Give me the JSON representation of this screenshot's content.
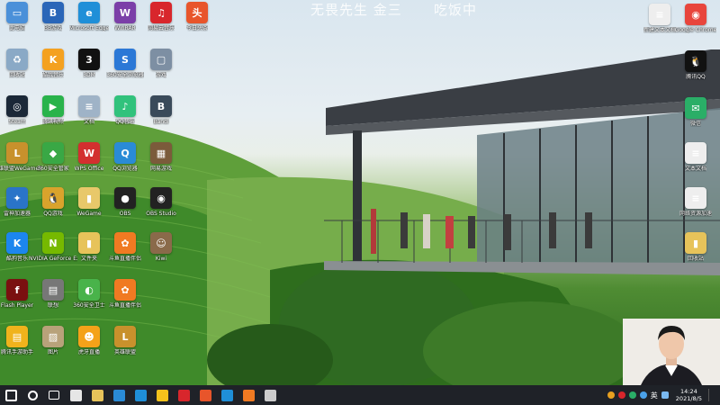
{
  "overlay": {
    "text_left": "无畏先生 金三",
    "text_right": "吃饭中"
  },
  "desktop_icons_left": [
    {
      "label": "此电脑",
      "color": "#4a90d9",
      "glyph": "▭"
    },
    {
      "label": "BB游戏",
      "color": "#2a66b8",
      "glyph": "B"
    },
    {
      "label": "Microsoft Edge",
      "color": "#1f8fd8",
      "glyph": "e"
    },
    {
      "label": "WinRAR",
      "color": "#7b3fa8",
      "glyph": "W"
    },
    {
      "label": "网易云音乐",
      "color": "#d8262c",
      "glyph": "♫"
    },
    {
      "label": "今日头条",
      "color": "#e8552b",
      "glyph": "头"
    },
    {
      "label": "回收站",
      "color": "#8aa9c6",
      "glyph": "♻"
    },
    {
      "label": "酷我音乐",
      "color": "#f4a120",
      "glyph": "K"
    },
    {
      "label": "3DM",
      "color": "#111111",
      "glyph": "3"
    },
    {
      "label": "360安全浏览器",
      "color": "#2b78d6",
      "glyph": "S"
    },
    {
      "label": "游戏",
      "color": "#7d8fa3",
      "glyph": "▢"
    },
    {
      "label": "Steam",
      "color": "#1b2838",
      "glyph": "◎"
    },
    {
      "label": "腾讯视频",
      "color": "#29b34b",
      "glyph": "▶"
    },
    {
      "label": "文档",
      "color": "#9fb3c7",
      "glyph": "≡"
    },
    {
      "label": "QQ音乐",
      "color": "#31c27c",
      "glyph": "♪"
    },
    {
      "label": "Bandi",
      "color": "#3a4a5a",
      "glyph": "B"
    },
    {
      "label": "英雄联盟WeGame版",
      "color": "#c8912c",
      "glyph": "L"
    },
    {
      "label": "360安全管家",
      "color": "#39a845",
      "glyph": "◆"
    },
    {
      "label": "WPS Office",
      "color": "#d32f2f",
      "glyph": "W"
    },
    {
      "label": "QQ浏览器",
      "color": "#2a8bd6",
      "glyph": "Q"
    },
    {
      "label": "网易游戏",
      "color": "#7b5b3b",
      "glyph": "▦"
    },
    {
      "label": "雷神加速器",
      "color": "#2a74c8",
      "glyph": "✦"
    },
    {
      "label": "QQ游戏",
      "color": "#d9a32c",
      "glyph": "🐧"
    },
    {
      "label": "WeGame",
      "color": "#e8c86a",
      "glyph": "▮"
    },
    {
      "label": "OBS",
      "color": "#222222",
      "glyph": "●"
    },
    {
      "label": "OBS Studio",
      "color": "#222222",
      "glyph": "◉"
    },
    {
      "label": "酷狗音乐",
      "color": "#1c86ee",
      "glyph": "K"
    },
    {
      "label": "NVIDIA GeForce Experience",
      "color": "#76b900",
      "glyph": "N"
    },
    {
      "label": "文件夹",
      "color": "#e7c35a",
      "glyph": "▮"
    },
    {
      "label": "斗鱼直播伴侣",
      "color": "#f07a22",
      "glyph": "✿"
    },
    {
      "label": "Kiwi",
      "color": "#8a6a4a",
      "glyph": "☺"
    },
    {
      "label": "Flash Player",
      "color": "#7a1010",
      "glyph": "f"
    },
    {
      "label": "联想",
      "color": "#777777",
      "glyph": "▤"
    },
    {
      "label": "360安全卫士",
      "color": "#49b34a",
      "glyph": "◐"
    },
    {
      "label": "斗鱼直播伴侣",
      "color": "#f07a22",
      "glyph": "✿"
    },
    {
      "label": "腾讯手游助手",
      "color": "#f0b31c",
      "glyph": "▤"
    },
    {
      "label": "图片",
      "color": "#b8a27a",
      "glyph": "▨"
    },
    {
      "label": "虎牙直播",
      "color": "#f4a219",
      "glyph": "☻"
    },
    {
      "label": "英雄联盟",
      "color": "#c8912c",
      "glyph": "L"
    }
  ],
  "desktop_icons_right": [
    {
      "label": "新建文本文档",
      "color": "#eeeeee",
      "glyph": "≡"
    },
    {
      "label": "Google Chrome",
      "color": "#e8453c",
      "glyph": "◉"
    },
    {
      "label": "腾讯QQ",
      "color": "#111111",
      "glyph": "🐧"
    },
    {
      "label": "微信",
      "color": "#2aae67",
      "glyph": "✉"
    },
    {
      "label": "文本文档",
      "color": "#eeeeee",
      "glyph": "≡"
    },
    {
      "label": "网络资源加速",
      "color": "#eeeeee",
      "glyph": "≡"
    },
    {
      "label": "回收站",
      "color": "#e7c35a",
      "glyph": "▮"
    }
  ],
  "taskbar": {
    "items": [
      {
        "name": "start",
        "color": "#ffffff"
      },
      {
        "name": "search",
        "color": "#ffffff"
      },
      {
        "name": "task-view",
        "color": "#ffffff"
      },
      {
        "name": "app-1",
        "color": "#e6e6e6"
      },
      {
        "name": "file-explorer",
        "color": "#e7c35a"
      },
      {
        "name": "browser-1",
        "color": "#2a8bd6"
      },
      {
        "name": "browser-2",
        "color": "#1f8fd8"
      },
      {
        "name": "qq-music",
        "color": "#f4c21c"
      },
      {
        "name": "netease",
        "color": "#d8262c"
      },
      {
        "name": "app-orange",
        "color": "#e8552b"
      },
      {
        "name": "edge",
        "color": "#1f8fd8"
      },
      {
        "name": "app-orange-2",
        "color": "#f07a22"
      },
      {
        "name": "obs",
        "color": "#cccccc"
      }
    ],
    "ime": "英",
    "time": "14:24",
    "date": "2021/8/5"
  }
}
